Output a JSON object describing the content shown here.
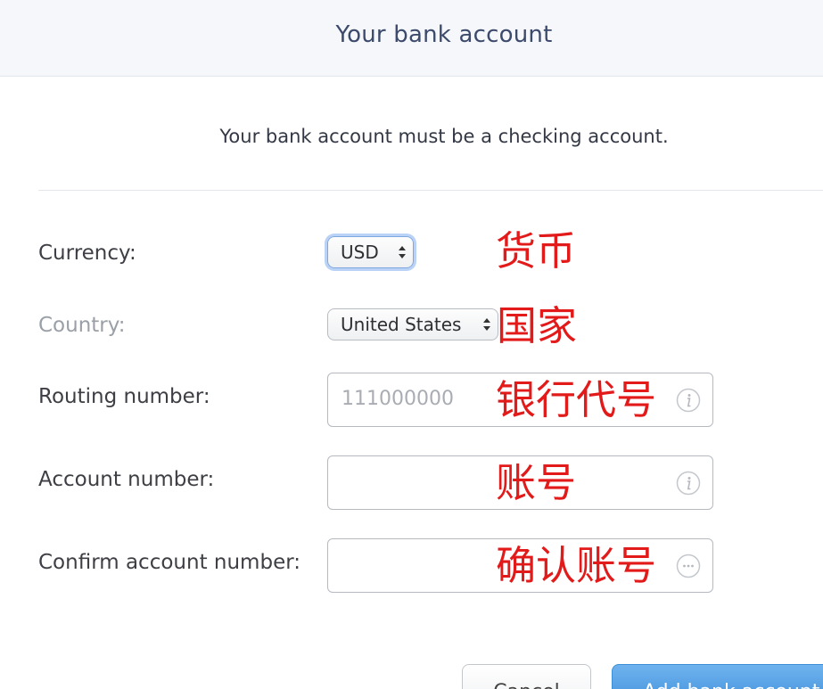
{
  "header": {
    "title": "Your bank account"
  },
  "notice": "Your bank account must be a checking account.",
  "form": {
    "currency": {
      "label": "Currency:",
      "value": "USD",
      "annotation": "货币"
    },
    "country": {
      "label": "Country:",
      "value": "United States",
      "annotation": "国家"
    },
    "routing": {
      "label": "Routing number:",
      "placeholder": "111000000",
      "annotation": "银行代号",
      "icon": "info-icon"
    },
    "account": {
      "label": "Account number:",
      "placeholder": "",
      "annotation": "账号",
      "icon": "info-icon"
    },
    "confirm": {
      "label": "Confirm account number:",
      "placeholder": "",
      "annotation": "确认账号",
      "icon": "more-icon"
    }
  },
  "buttons": {
    "cancel": "Cancel",
    "add": "Add bank account"
  },
  "colors": {
    "annotation": "#e21a1a",
    "header_bg": "#f5f7fa",
    "primary": "#3f8fdb",
    "focus_ring": "#b9d2f5"
  }
}
